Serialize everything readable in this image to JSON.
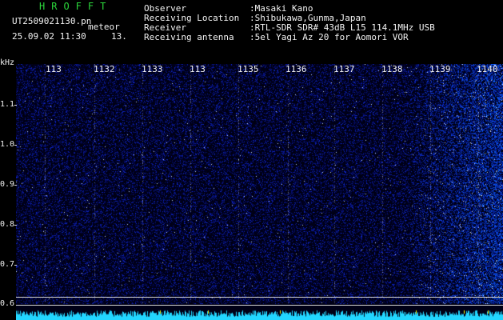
{
  "header": {
    "app_title": "HROFFT",
    "file_name": "UT2509021130.pn",
    "meteor": "meteor",
    "date_time": "25.09.02 11:30",
    "count": "13.",
    "info": [
      {
        "label": "Observer",
        "value": ":Masaki Kano"
      },
      {
        "label": "Receiving Location",
        "value": ":Shibukawa,Gunma,Japan"
      },
      {
        "label": "Receiver",
        "value": ":RTL-SDR SDR# 43dB L15 114.1MHz USB"
      },
      {
        "label": "Receiving antenna",
        "value": ":5el Yagi Az 20 for Aomori VOR"
      }
    ]
  },
  "y_axis": {
    "unit": "kHz",
    "ticks": [
      "1.1",
      "1.0",
      "0.9",
      "0.8",
      "0.7",
      "0.6"
    ]
  },
  "x_axis": {
    "ticks": [
      "113",
      "1132",
      "1133",
      "113",
      "1135",
      "1136",
      "1137",
      "1138",
      "1139",
      "1140"
    ]
  },
  "colors": {
    "background": "#000000",
    "header_green": "#2bd63b",
    "header_yellow": "#ffff00",
    "spectrum_blue": "#0a1a8c",
    "noise_floor": "#22d6ff"
  }
}
